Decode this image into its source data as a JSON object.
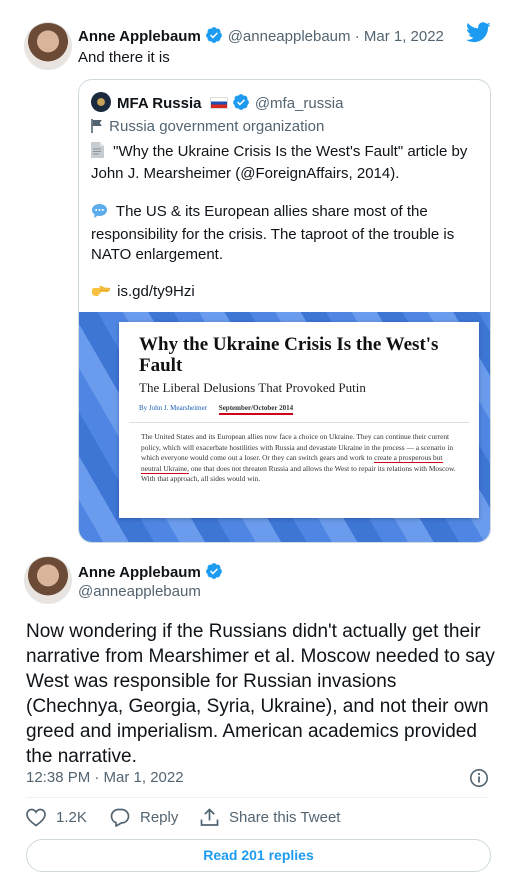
{
  "top_tweet": {
    "author_name": "Anne Applebaum",
    "handle_date": "@anneapplebaum · Mar 1, 2022",
    "text": "And there it is"
  },
  "quote": {
    "author_name": "MFA Russia",
    "handle": "@mfa_russia",
    "org_label": "Russia government organization",
    "line1": "\"Why the Ukraine Crisis Is the West's Fault\" article by",
    "line2": "John J. Mearsheimer (@ForeignAffairs, 2014).",
    "para2_line1": "The US & its European allies share most of the",
    "para2_line2": "responsibility for the crisis. The taproot of the trouble is",
    "para2_line3": "NATO enlargement.",
    "link": "is.gd/ty9Hzi",
    "article": {
      "title": "Why the Ukraine Crisis Is the West's Fault",
      "subtitle": "The Liberal Delusions That Provoked Putin",
      "byline": "By John J. Mearsheimer",
      "issue": "September/October 2014",
      "body_1": "The United States and its European allies now face a choice on Ukraine. They can continue their current policy, which will exacerbate hostilities with Russia and devastate Ukraine in the process — a scenario in which everyone would come out a loser. Or they can switch gears and work to ",
      "body_underlined": "create a prosperous but neutral Ukraine,",
      "body_2": " one that does not threaten Russia and allows the West to repair its relations with Moscow. With that approach, all sides would win."
    }
  },
  "main_tweet": {
    "author_name": "Anne Applebaum",
    "handle": "@anneapplebaum",
    "text": "Now wondering if the Russians didn't actually get their narrative from Mearshimer et al. Moscow needed to say West was responsible for Russian invasions (Chechnya, Georgia, Syria, Ukraine), and not their own greed and imperialism. American academics provided the narrative.",
    "timestamp": "12:38 PM · Mar 1, 2022"
  },
  "actions": {
    "like_count": "1.2K",
    "reply_label": "Reply",
    "share_label": "Share this Tweet"
  },
  "read_replies": "Read 201 replies",
  "colors": {
    "accent": "#1d9bf0",
    "secondary_text": "#536471",
    "border": "#cfd9de"
  },
  "icons": [
    "twitter-bird-icon",
    "verified-badge-icon",
    "flag-russia-icon",
    "flag-icon",
    "document-icon",
    "speech-bubble-icon",
    "pointing-hand-icon",
    "info-icon",
    "heart-icon",
    "reply-icon",
    "share-icon"
  ]
}
